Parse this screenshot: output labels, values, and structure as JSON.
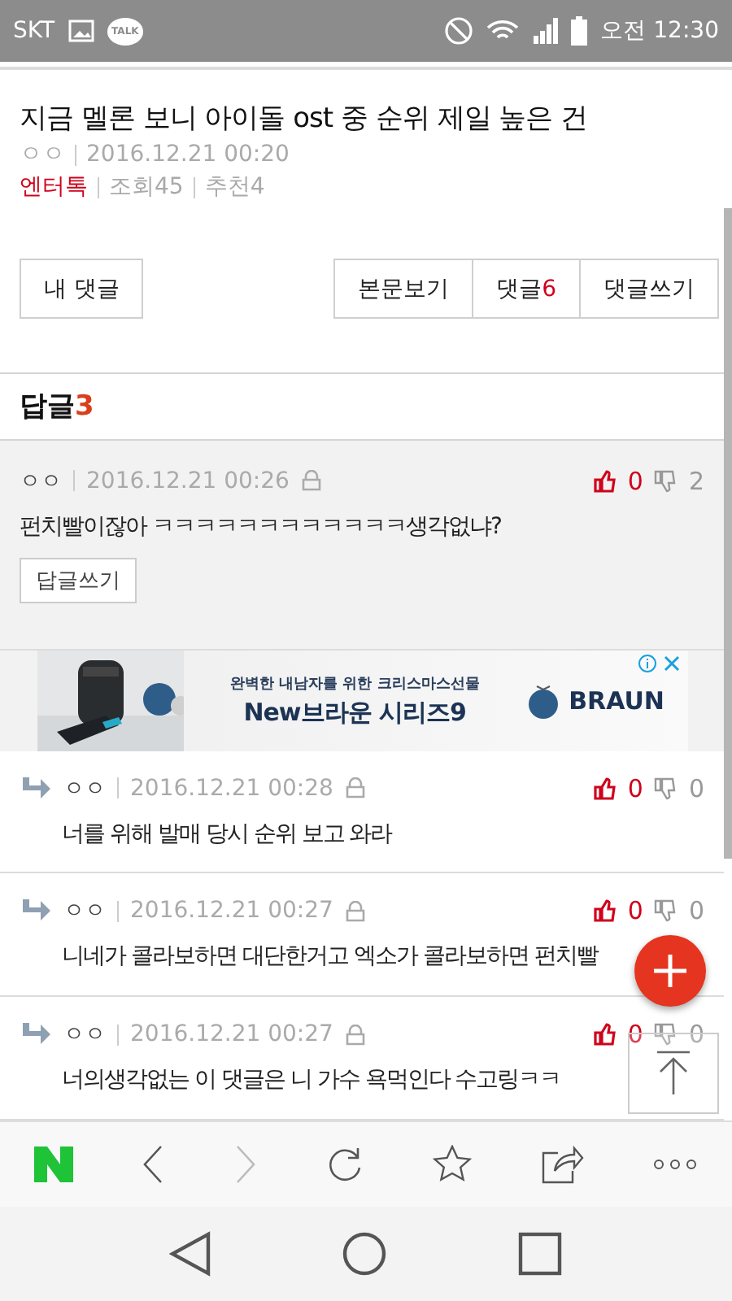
{
  "status_bar": {
    "carrier": "SKT",
    "talk_badge": "TALK",
    "time": "오전 12:30"
  },
  "post": {
    "title": "지금 멜론 보니 아이돌 ost 중 순위 제일 높은 건",
    "author": "ㅇㅇ",
    "date": "2016.12.21 00:20",
    "category": "엔터톡",
    "views": "조회45",
    "recommends": "추천4"
  },
  "actions": {
    "my_comments": "내 댓글",
    "view_post": "본문보기",
    "comments_label": "댓글",
    "comments_count": "6",
    "write_comment": "댓글쓰기"
  },
  "replies_header": {
    "label": "답글",
    "count": "3"
  },
  "comments": [
    {
      "kind": "parent",
      "author": "ㅇㅇ",
      "date": "2016.12.21 00:26",
      "likes": "0",
      "dislikes": "2",
      "text": "펀치빨이잖아 ㅋㅋㅋㅋㅋㅋㅋㅋㅋㅋㅋㅋ생각없냐?",
      "reply_button": "답글쓰기"
    },
    {
      "kind": "reply",
      "author": "ㅇㅇ",
      "date": "2016.12.21 00:28",
      "likes": "0",
      "dislikes": "0",
      "text": "너를 위해 발매 당시 순위 보고 와라"
    },
    {
      "kind": "reply",
      "author": "ㅇㅇ",
      "date": "2016.12.21 00:27",
      "likes": "0",
      "dislikes": "0",
      "text": "니네가 콜라보하면 대단한거고 엑소가 콜라보하면 펀치빨"
    },
    {
      "kind": "reply",
      "author": "ㅇㅇ",
      "date": "2016.12.21 00:27",
      "likes": "0",
      "dislikes": "0",
      "text": "너의생각없는 이 댓글은 니 가수 욕먹인다 수고링ㅋㅋ"
    }
  ],
  "ad": {
    "headline": "완벽한 내남자를 위한 크리스마스선물",
    "title": "New브라운 시리즈9",
    "brand": "BRAUN"
  },
  "browser_toolbar": {
    "forward_disabled": true
  }
}
